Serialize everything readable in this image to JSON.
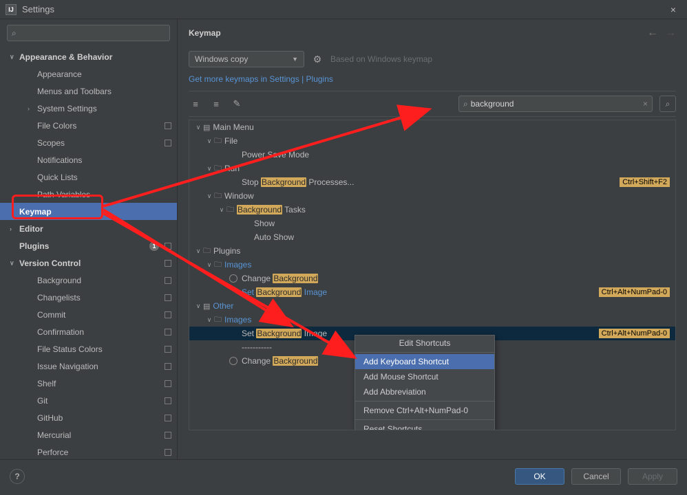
{
  "window": {
    "title": "Settings"
  },
  "sidebar": {
    "search_placeholder": "",
    "items": [
      {
        "label": "Appearance & Behavior"
      },
      {
        "label": "Appearance"
      },
      {
        "label": "Menus and Toolbars"
      },
      {
        "label": "System Settings"
      },
      {
        "label": "File Colors"
      },
      {
        "label": "Scopes"
      },
      {
        "label": "Notifications"
      },
      {
        "label": "Quick Lists"
      },
      {
        "label": "Path Variables"
      },
      {
        "label": "Keymap"
      },
      {
        "label": "Editor"
      },
      {
        "label": "Plugins",
        "count": "1"
      },
      {
        "label": "Version Control"
      },
      {
        "label": "Background"
      },
      {
        "label": "Changelists"
      },
      {
        "label": "Commit"
      },
      {
        "label": "Confirmation"
      },
      {
        "label": "File Status Colors"
      },
      {
        "label": "Issue Navigation"
      },
      {
        "label": "Shelf"
      },
      {
        "label": "Git"
      },
      {
        "label": "GitHub"
      },
      {
        "label": "Mercurial"
      },
      {
        "label": "Perforce"
      }
    ]
  },
  "main": {
    "breadcrumb": "Keymap",
    "keymap_name": "Windows copy",
    "based_on": "Based on Windows keymap",
    "more_link": "Get more keymaps in Settings | Plugins",
    "search_value": "background",
    "tree": {
      "main_menu": "Main Menu",
      "file": "File",
      "power_save": "Power Save Mode",
      "run": "Run",
      "stop_bg_pre": "Stop ",
      "stop_bg_hl": "Background",
      "stop_bg_post": " Processes...",
      "stop_bg_shortcut": "Ctrl+Shift+F2",
      "window": "Window",
      "bg_tasks_hl": "Background",
      "bg_tasks_post": " Tasks",
      "show": "Show",
      "auto_show": "Auto Show",
      "plugins": "Plugins",
      "images": "Images",
      "change_bg_pre": "Change ",
      "change_bg_hl": "Background",
      "set_bg_pre": "Set ",
      "set_bg_hl": "Background",
      "set_bg_post": " Image",
      "set_bg_shortcut": "Ctrl+Alt+NumPad-0",
      "other": "Other",
      "separator": "-----------"
    },
    "ctx": {
      "header": "Edit Shortcuts",
      "add_kb": "Add Keyboard Shortcut",
      "add_mouse": "Add Mouse Shortcut",
      "add_abbr": "Add Abbreviation",
      "remove": "Remove Ctrl+Alt+NumPad-0",
      "reset": "Reset Shortcuts"
    }
  },
  "footer": {
    "ok": "OK",
    "cancel": "Cancel",
    "apply": "Apply"
  }
}
